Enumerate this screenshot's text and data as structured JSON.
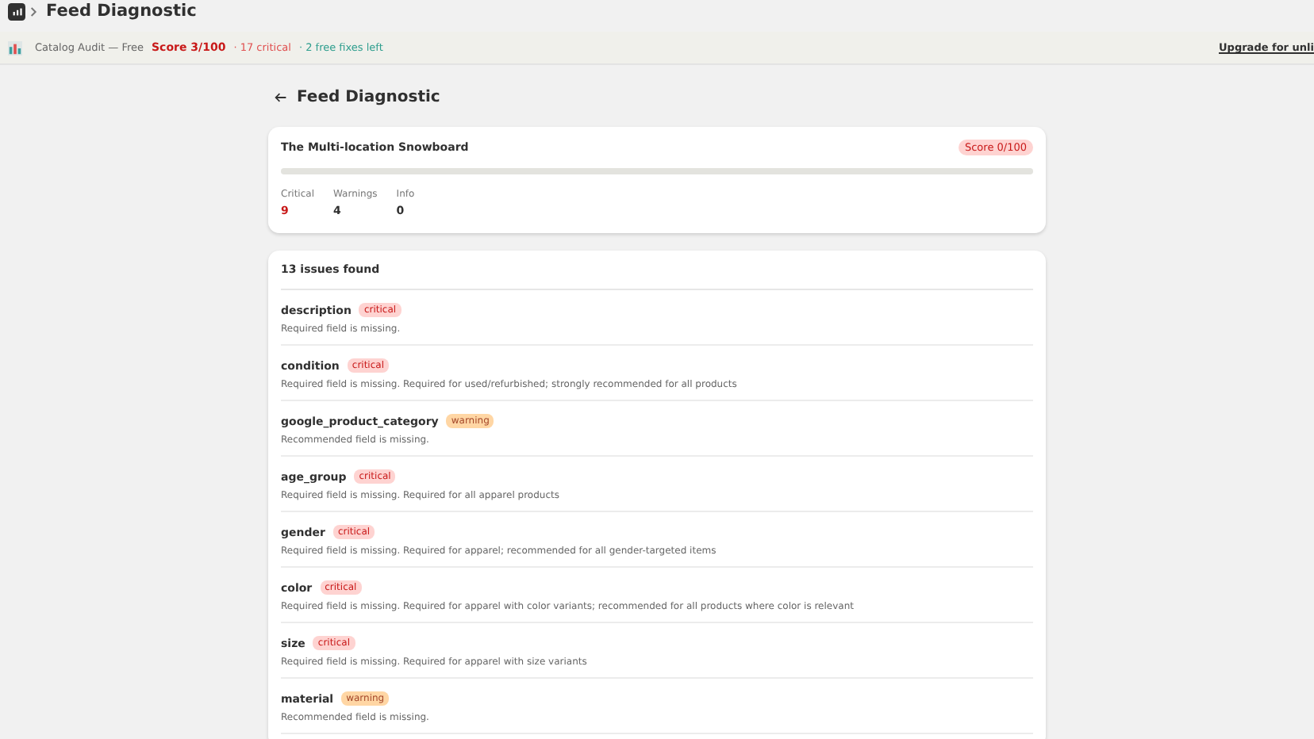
{
  "header": {
    "title": "Feed Diagnostic"
  },
  "banner": {
    "app": "Catalog Audit — Free",
    "score": "Score 3/100",
    "critical": "· 17 critical",
    "fixes": "· 2 free fixes left",
    "upgrade": "Upgrade for unli"
  },
  "page": {
    "title": "Feed Diagnostic"
  },
  "product": {
    "name": "The Multi-location Snowboard",
    "score": "Score 0/100",
    "stats": [
      {
        "label": "Critical",
        "value": "9",
        "kind": "critical"
      },
      {
        "label": "Warnings",
        "value": "4",
        "kind": "normal"
      },
      {
        "label": "Info",
        "value": "0",
        "kind": "normal"
      }
    ]
  },
  "issues": {
    "heading": "13 issues found",
    "items": [
      {
        "field": "description",
        "severity": "critical",
        "message": "Required field is missing."
      },
      {
        "field": "condition",
        "severity": "critical",
        "message": "Required field is missing. Required for used/refurbished; strongly recommended for all products"
      },
      {
        "field": "google_product_category",
        "severity": "warning",
        "message": "Recommended field is missing."
      },
      {
        "field": "age_group",
        "severity": "critical",
        "message": "Required field is missing. Required for all apparel products"
      },
      {
        "field": "gender",
        "severity": "critical",
        "message": "Required field is missing. Required for apparel; recommended for all gender-targeted items"
      },
      {
        "field": "color",
        "severity": "critical",
        "message": "Required field is missing. Required for apparel with color variants; recommended for all products where color is relevant"
      },
      {
        "field": "size",
        "severity": "critical",
        "message": "Required field is missing. Required for apparel with size variants"
      },
      {
        "field": "material",
        "severity": "warning",
        "message": "Recommended field is missing."
      }
    ]
  }
}
